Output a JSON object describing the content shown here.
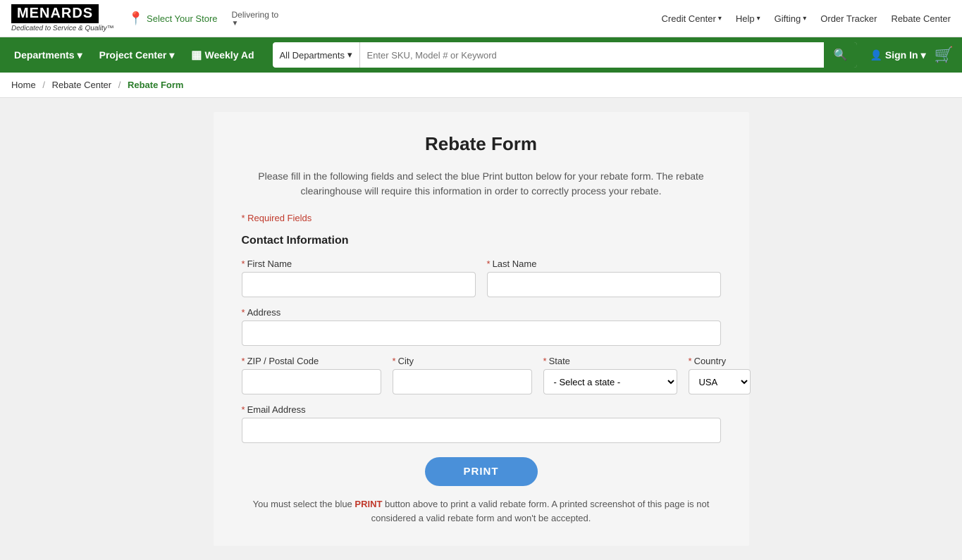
{
  "topbar": {
    "logo": "MENARDS",
    "tagline": "Dedicated to Service & Quality™",
    "store_label": "Select Your Store",
    "delivering_label": "Delivering to",
    "nav_links": [
      {
        "label": "Credit Center",
        "has_arrow": true
      },
      {
        "label": "Help",
        "has_arrow": true
      },
      {
        "label": "Gifting",
        "has_arrow": true
      },
      {
        "label": "Order Tracker",
        "has_arrow": false
      },
      {
        "label": "Rebate Center",
        "has_arrow": false
      }
    ]
  },
  "navbar": {
    "departments_label": "Departments",
    "project_center_label": "Project Center",
    "weekly_ad_label": "Weekly Ad",
    "search_dept_label": "All Departments",
    "search_placeholder": "Enter SKU, Model # or Keyword",
    "sign_in_label": "Sign In"
  },
  "breadcrumb": {
    "home": "Home",
    "rebate_center": "Rebate Center",
    "current": "Rebate Form"
  },
  "form": {
    "title": "Rebate Form",
    "description": "Please fill in the following fields and select the blue Print button below for your rebate form. The rebate clearinghouse will require this information in order to correctly process your rebate.",
    "required_note": "* Required Fields",
    "contact_section": "Contact Information",
    "fields": {
      "first_name_label": "First Name",
      "last_name_label": "Last Name",
      "address_label": "Address",
      "zip_label": "ZIP / Postal Code",
      "city_label": "City",
      "state_label": "State",
      "country_label": "Country",
      "email_label": "Email Address",
      "state_placeholder": "- Select a state -",
      "country_default": "USA"
    },
    "print_button": "PRINT",
    "print_note": "You must select the blue PRINT button above to print a valid rebate form. A printed screenshot of this page is not considered a valid rebate form and won't be accepted."
  }
}
